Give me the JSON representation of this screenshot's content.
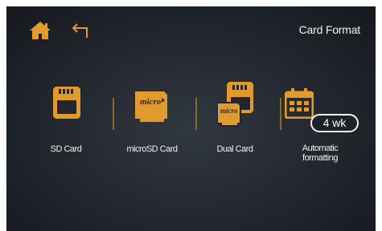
{
  "header": {
    "title": "Card Format",
    "home_icon": "home-icon",
    "back_icon": "back-arrow-icon"
  },
  "options": [
    {
      "label": "SD Card",
      "icon": "sd-card-icon"
    },
    {
      "label": "microSD Card",
      "icon": "microsd-card-icon",
      "card_text": "micro"
    },
    {
      "label": "Dual Card",
      "icon": "dual-card-icon",
      "card_text": "micro"
    },
    {
      "label": "Automatic formatting",
      "icon": "calendar-icon",
      "badge": "4 wk"
    }
  ],
  "colors": {
    "accent": "#e39a2d",
    "background": "#22272e",
    "text": "#f0f0f0"
  }
}
